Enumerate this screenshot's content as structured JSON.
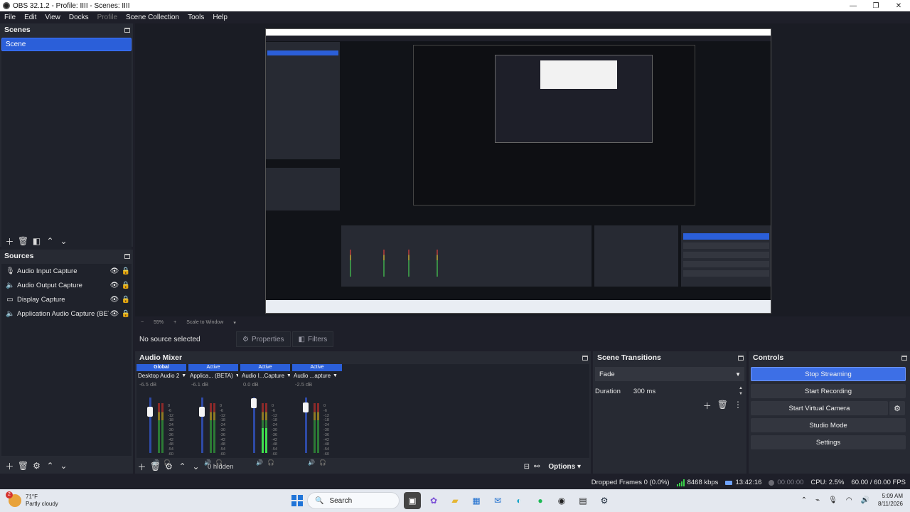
{
  "window": {
    "title": "OBS 32.1.2 - Profile: IIII - Scenes: IIII",
    "minimize": "—",
    "maximize": "❐",
    "close": "✕"
  },
  "menu": [
    {
      "label": "File",
      "enabled": true
    },
    {
      "label": "Edit",
      "enabled": true
    },
    {
      "label": "View",
      "enabled": true
    },
    {
      "label": "Docks",
      "enabled": true
    },
    {
      "label": "Profile",
      "enabled": false
    },
    {
      "label": "Scene Collection",
      "enabled": true
    },
    {
      "label": "Tools",
      "enabled": true
    },
    {
      "label": "Help",
      "enabled": true
    }
  ],
  "scenes": {
    "title": "Scenes",
    "items": [
      "Scene"
    ],
    "selected": 0
  },
  "sources": {
    "title": "Sources",
    "items": [
      {
        "label": "Audio Input Capture",
        "icon": "microphone-icon"
      },
      {
        "label": "Audio Output Capture",
        "icon": "speaker-icon"
      },
      {
        "label": "Display Capture",
        "icon": "monitor-icon"
      },
      {
        "label": "Application Audio Capture (BETA)",
        "icon": "speaker-icon"
      }
    ]
  },
  "preview_strip": {
    "minus": "−",
    "zoom": "55%",
    "plus": "+",
    "scale_mode": "Scale to Window"
  },
  "context": {
    "no_source": "No source selected",
    "properties": "Properties",
    "filters": "Filters"
  },
  "mixer": {
    "title": "Audio Mixer",
    "channels": [
      {
        "header": "Global",
        "name": "Desktop Audio 2",
        "db": "-6.5 dB",
        "fader": 0.8
      },
      {
        "header": "Active",
        "name": "Applica... (BETA)",
        "db": "-6.1 dB",
        "fader": 0.8
      },
      {
        "header": "Active",
        "name": "Audio I...Capture",
        "db": "0.0 dB",
        "fader": 1.0
      },
      {
        "header": "Active",
        "name": "Audio ...apture",
        "db": "-2.5 dB",
        "fader": 0.9
      }
    ],
    "ticks": [
      "0",
      "-6",
      "-12",
      "-18",
      "-24",
      "-30",
      "-36",
      "-42",
      "-48",
      "-54",
      "-60"
    ],
    "hidden": "0 hidden",
    "options": "Options"
  },
  "transitions": {
    "title": "Scene Transitions",
    "selected": "Fade",
    "duration_label": "Duration",
    "duration_value": "300 ms"
  },
  "controls": {
    "title": "Controls",
    "stop_streaming": "Stop Streaming",
    "start_recording": "Start Recording",
    "start_virtual_camera": "Start Virtual Camera",
    "studio_mode": "Studio Mode",
    "settings": "Settings"
  },
  "status": {
    "dropped_frames": "Dropped Frames 0 (0.0%)",
    "bitrate": "8468 kbps",
    "stream_time": "13:42:16",
    "record_time": "00:00:00",
    "cpu": "CPU: 2.5%",
    "fps": "60.00 / 60.00 FPS"
  },
  "taskbar": {
    "weather_temp": "71°F",
    "weather_desc": "Partly cloudy",
    "weather_badge": "2",
    "search": "Search",
    "time": "5:09 AM",
    "date": "8/11/2026"
  },
  "colors": {
    "accent": "#2b5fd9",
    "meter_green": "#3fe04e",
    "background": "#1e1f29"
  }
}
